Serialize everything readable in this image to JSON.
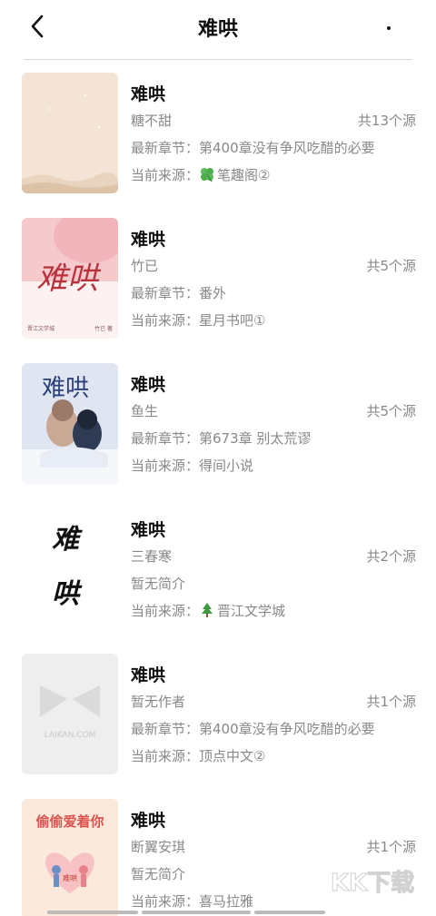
{
  "header": {
    "title": "难哄"
  },
  "books": [
    {
      "title": "难哄",
      "author": "糖不甜",
      "sources_count": "共13个源",
      "second_label": "最新章节：",
      "second_value": "第400章没有争风吃醋的必要",
      "source_label": "当前来源：",
      "source_icon": "clover-icon",
      "source_name": "笔趣阁②",
      "cover_color": "#f3e4d6"
    },
    {
      "title": "难哄",
      "author": "竹已",
      "sources_count": "共5个源",
      "second_label": "最新章节：",
      "second_value": "番外",
      "source_label": "当前来源：",
      "source_icon": "",
      "source_name": "星月书吧①",
      "cover_color": "#f6c9cd",
      "cover_text": "难哄",
      "cover_footer_left": "晋江文学城",
      "cover_footer_right": "竹已 著"
    },
    {
      "title": "难哄",
      "author": "鱼生",
      "sources_count": "共5个源",
      "second_label": "最新章节：",
      "second_value": "第673章 别太荒谬",
      "source_label": "当前来源：",
      "source_icon": "",
      "source_name": "得间小说",
      "cover_color": "#dfe6f1",
      "cover_text": "难哄"
    },
    {
      "title": "难哄",
      "author": "三春寒",
      "sources_count": "共2个源",
      "second_label": "",
      "second_value": "暂无简介",
      "source_label": "当前来源：",
      "source_icon": "tree-icon",
      "source_name": "晋江文学城",
      "cover_color": "#ffffff",
      "cover_text_1": "难",
      "cover_text_2": "哄"
    },
    {
      "title": "难哄",
      "author": "暂无作者",
      "sources_count": "共1个源",
      "second_label": "最新章节：",
      "second_value": "第400章没有争风吃醋的必要",
      "source_label": "当前来源：",
      "source_icon": "",
      "source_name": "顶点中文②",
      "cover_color": "#eeeeee",
      "cover_text": "LAIKAN.COM"
    },
    {
      "title": "难哄",
      "author": "断翼安琪",
      "sources_count": "共1个源",
      "second_label": "",
      "second_value": "暂无简介",
      "source_label": "当前来源：",
      "source_icon": "",
      "source_name": "喜马拉雅",
      "cover_color": "#fbe9dc",
      "cover_text": "偷偷爱着你",
      "cover_small": "难哄"
    }
  ],
  "watermark": "KK下载"
}
